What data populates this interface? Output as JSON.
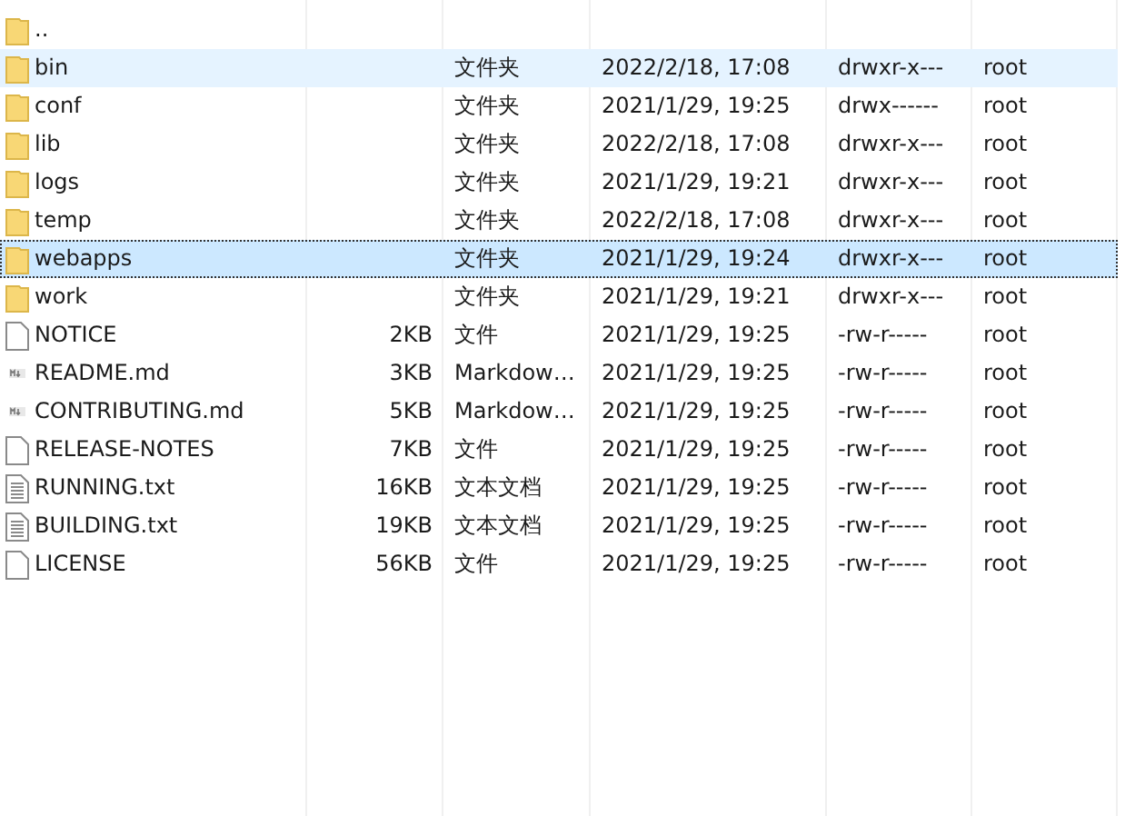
{
  "rows": [
    {
      "kind": "folder",
      "name": "..",
      "hovered": false,
      "selected": false
    },
    {
      "kind": "folder",
      "name": "bin",
      "type": "文件夹",
      "modified": "2022/2/18, 17:08",
      "rights": "drwxr-x---",
      "owner": "root",
      "hovered": true,
      "selected": false
    },
    {
      "kind": "folder",
      "name": "conf",
      "type": "文件夹",
      "modified": "2021/1/29, 19:25",
      "rights": "drwx------",
      "owner": "root",
      "hovered": false,
      "selected": false
    },
    {
      "kind": "folder",
      "name": "lib",
      "type": "文件夹",
      "modified": "2022/2/18, 17:08",
      "rights": "drwxr-x---",
      "owner": "root",
      "hovered": false,
      "selected": false
    },
    {
      "kind": "folder",
      "name": "logs",
      "type": "文件夹",
      "modified": "2021/1/29, 19:21",
      "rights": "drwxr-x---",
      "owner": "root",
      "hovered": false,
      "selected": false
    },
    {
      "kind": "folder",
      "name": "temp",
      "type": "文件夹",
      "modified": "2022/2/18, 17:08",
      "rights": "drwxr-x---",
      "owner": "root",
      "hovered": false,
      "selected": false
    },
    {
      "kind": "folder",
      "name": "webapps",
      "type": "文件夹",
      "modified": "2021/1/29, 19:24",
      "rights": "drwxr-x---",
      "owner": "root",
      "hovered": false,
      "selected": true
    },
    {
      "kind": "folder",
      "name": "work",
      "type": "文件夹",
      "modified": "2021/1/29, 19:21",
      "rights": "drwxr-x---",
      "owner": "root",
      "hovered": false,
      "selected": false
    },
    {
      "kind": "file",
      "name": "NOTICE",
      "size": "2KB",
      "type": "文件",
      "modified": "2021/1/29, 19:25",
      "rights": "-rw-r-----",
      "owner": "root",
      "hovered": false,
      "selected": false
    },
    {
      "kind": "markdown",
      "name": "README.md",
      "size": "3KB",
      "type": "Markdow…",
      "modified": "2021/1/29, 19:25",
      "rights": "-rw-r-----",
      "owner": "root",
      "hovered": false,
      "selected": false
    },
    {
      "kind": "markdown",
      "name": "CONTRIBUTING.md",
      "size": "5KB",
      "type": "Markdow…",
      "modified": "2021/1/29, 19:25",
      "rights": "-rw-r-----",
      "owner": "root",
      "hovered": false,
      "selected": false
    },
    {
      "kind": "file",
      "name": "RELEASE-NOTES",
      "size": "7KB",
      "type": "文件",
      "modified": "2021/1/29, 19:25",
      "rights": "-rw-r-----",
      "owner": "root",
      "hovered": false,
      "selected": false
    },
    {
      "kind": "text",
      "name": "RUNNING.txt",
      "size": "16KB",
      "type": "文本文档",
      "modified": "2021/1/29, 19:25",
      "rights": "-rw-r-----",
      "owner": "root",
      "hovered": false,
      "selected": false
    },
    {
      "kind": "text",
      "name": "BUILDING.txt",
      "size": "19KB",
      "type": "文本文档",
      "modified": "2021/1/29, 19:25",
      "rights": "-rw-r-----",
      "owner": "root",
      "hovered": false,
      "selected": false
    },
    {
      "kind": "file",
      "name": "LICENSE",
      "size": "56KB",
      "type": "文件",
      "modified": "2021/1/29, 19:25",
      "rights": "-rw-r-----",
      "owner": "root",
      "hovered": false,
      "selected": false
    }
  ]
}
